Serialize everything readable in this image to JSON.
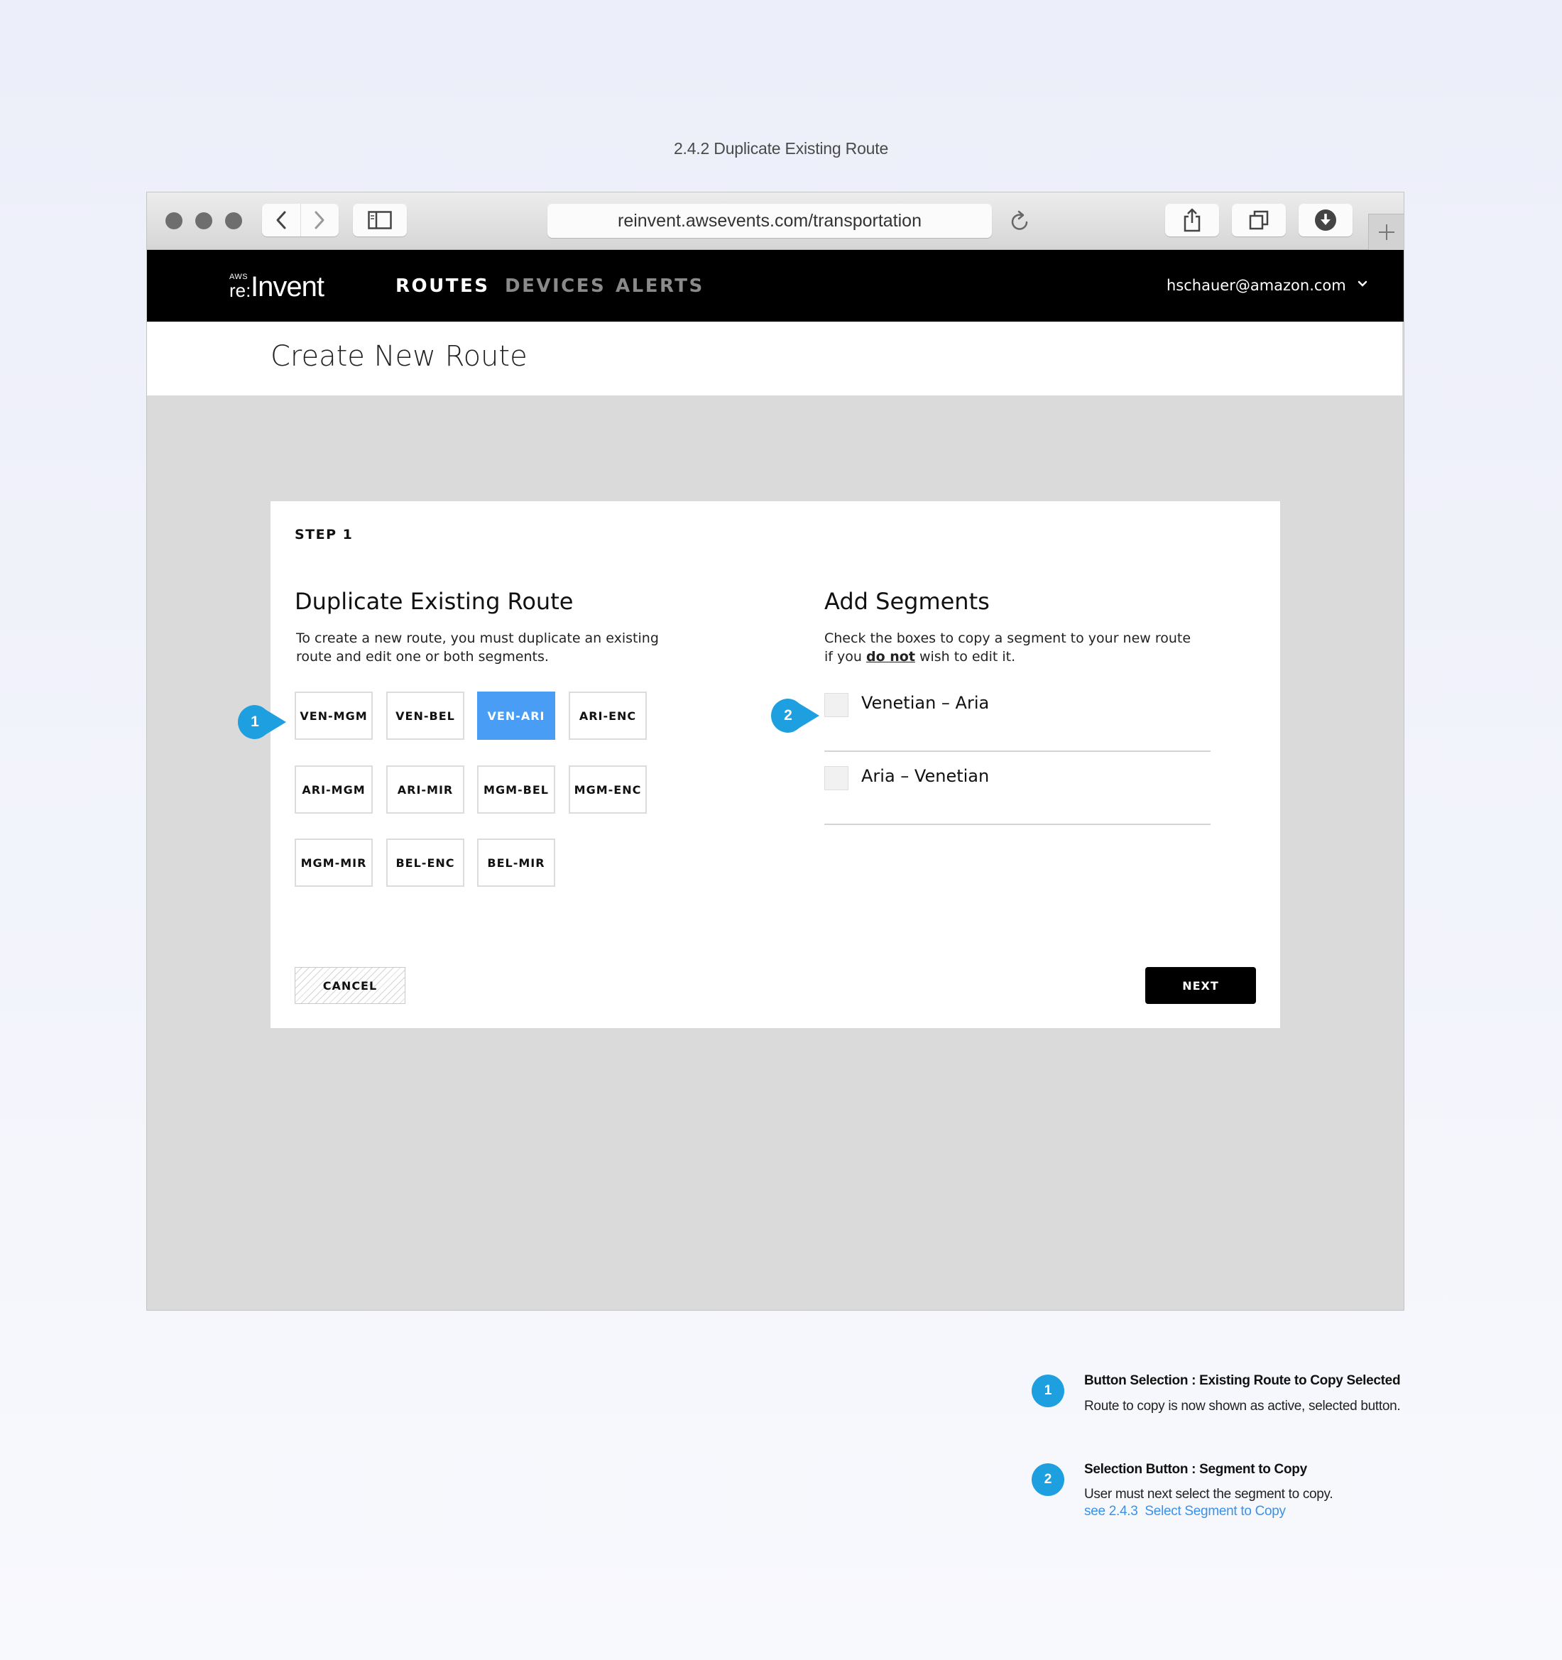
{
  "doc_title": "2.4.2 Duplicate Existing Route",
  "browser": {
    "url": "reinvent.awsevents.com/transportation"
  },
  "nav": {
    "logo_small": "AWS",
    "logo_re": "re:",
    "logo_main": "Invent",
    "links": [
      {
        "label": "ROUTES",
        "active": true
      },
      {
        "label": "DEVICES",
        "active": false
      },
      {
        "label": "ALERTS",
        "active": false
      }
    ],
    "user_email": "hschauer@amazon.com"
  },
  "page": {
    "title": "Create New Route"
  },
  "card": {
    "step": "STEP 1",
    "duplicate": {
      "title": "Duplicate Existing Route",
      "desc_line1": "To create a new route, you must duplicate an existing",
      "desc_line2": "route and edit one or both segments.",
      "routes": [
        {
          "label": "VEN-MGM",
          "active": false
        },
        {
          "label": "VEN-BEL",
          "active": false
        },
        {
          "label": "VEN-ARI",
          "active": true
        },
        {
          "label": "ARI-ENC",
          "active": false
        },
        {
          "label": "ARI-MGM",
          "active": false
        },
        {
          "label": "ARI-MIR",
          "active": false
        },
        {
          "label": "MGM-BEL",
          "active": false
        },
        {
          "label": "MGM-ENC",
          "active": false
        },
        {
          "label": "MGM-MIR",
          "active": false
        },
        {
          "label": "BEL-ENC",
          "active": false
        },
        {
          "label": "BEL-MIR",
          "active": false
        }
      ]
    },
    "segments": {
      "title": "Add Segments",
      "desc_line1": "Check the boxes to copy a segment to your new route",
      "desc_pre": "if you ",
      "desc_emph": "do not",
      "desc_post": " wish to edit it.",
      "items": [
        {
          "label": "Venetian – Aria",
          "checked": false
        },
        {
          "label": "Aria – Venetian",
          "checked": false
        }
      ]
    },
    "cancel_label": "CANCEL",
    "next_label": "NEXT"
  },
  "markers": [
    "1",
    "2"
  ],
  "notes": [
    {
      "num": "1",
      "title": "Button Selection : Existing Route to Copy Selected",
      "text": "Route to copy is now shown as active, selected button."
    },
    {
      "num": "2",
      "title": "Selection Button : Segment to Copy",
      "text": "User must next select the segment to copy.",
      "link": "see 2.4.3  Select Segment to Copy"
    }
  ],
  "colors": {
    "accent_blue": "#4a9df5",
    "marker_blue": "#1d9fe0",
    "link_blue": "#3a91e8"
  }
}
